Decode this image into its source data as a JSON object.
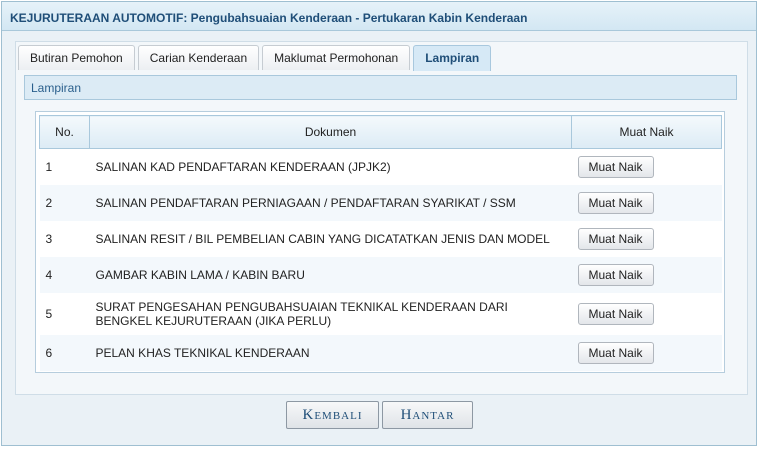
{
  "window": {
    "title": "KEJURUTERAAN AUTOMOTIF: Pengubahsuaian Kenderaan - Pertukaran Kabin Kenderaan"
  },
  "tabs": [
    {
      "label": "Butiran Pemohon",
      "active": false
    },
    {
      "label": "Carian Kenderaan",
      "active": false
    },
    {
      "label": "Maklumat Permohonan",
      "active": false
    },
    {
      "label": "Lampiran",
      "active": true
    }
  ],
  "section": {
    "title": "Lampiran"
  },
  "table": {
    "headers": {
      "no": "No.",
      "dokumen": "Dokumen",
      "muat_naik": "Muat Naik"
    },
    "rows": [
      {
        "no": "1",
        "dokumen": "SALINAN KAD PENDAFTARAN KENDERAAN (JPJK2)",
        "button": "Muat Naik"
      },
      {
        "no": "2",
        "dokumen": "SALINAN PENDAFTARAN PERNIAGAAN / PENDAFTARAN SYARIKAT / SSM",
        "button": "Muat Naik"
      },
      {
        "no": "3",
        "dokumen": "SALINAN RESIT / BIL PEMBELIAN CABIN YANG DICATATKAN JENIS DAN MODEL",
        "button": "Muat Naik"
      },
      {
        "no": "4",
        "dokumen": "GAMBAR KABIN LAMA / KABIN BARU",
        "button": "Muat Naik"
      },
      {
        "no": "5",
        "dokumen": "SURAT PENGESAHAN PENGUBAHSUAIAN TEKNIKAL KENDERAAN DARI BENGKEL KEJURUTERAAN (JIKA PERLU)",
        "button": "Muat Naik"
      },
      {
        "no": "6",
        "dokumen": "PELAN KHAS TEKNIKAL KENDERAAN",
        "button": "Muat Naik"
      }
    ]
  },
  "actions": {
    "back_label": "Kembali",
    "submit_label": "Hantar"
  },
  "colors": {
    "title_text": "#1f4e78",
    "header_bg": "#dcebf5",
    "border": "#a9c8dc"
  }
}
